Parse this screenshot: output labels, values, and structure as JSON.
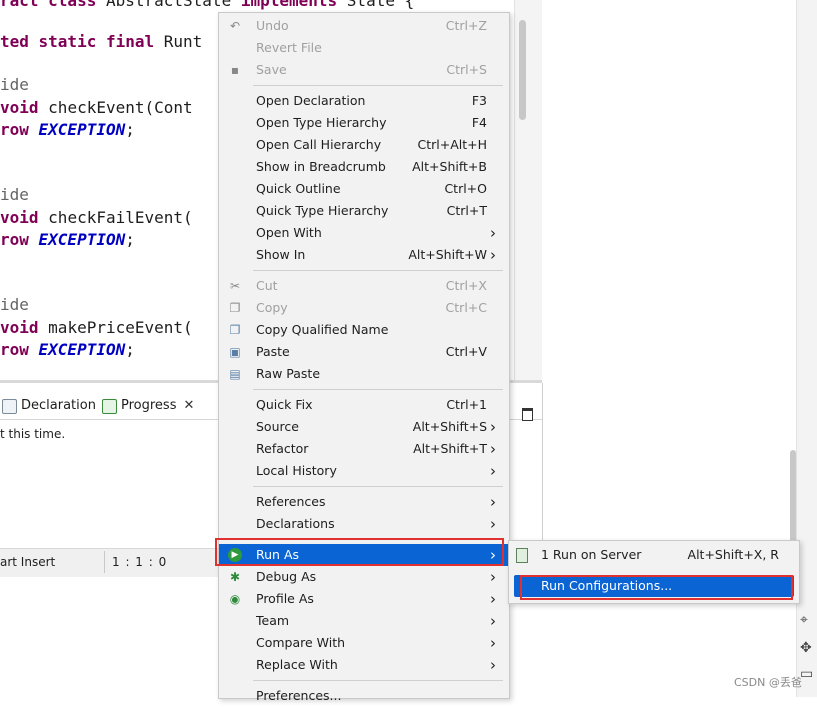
{
  "editor": {
    "lines": [
      {
        "parts": [
          [
            "kw",
            "ract class "
          ],
          [
            "",
            "AbstractState "
          ],
          [
            "kw",
            "implements "
          ],
          [
            "",
            "State {"
          ]
        ]
      },
      {
        "parts": [
          [
            "kw",
            "ted static final "
          ],
          [
            "",
            "Runt"
          ]
        ]
      },
      {
        "parts": [
          [
            "ann",
            "ide"
          ]
        ]
      },
      {
        "parts": [
          [
            "kw",
            "void "
          ],
          [
            "",
            "checkEvent(Cont"
          ]
        ]
      },
      {
        "parts": [
          [
            "kw",
            "row "
          ],
          [
            "ex",
            "EXCEPTION"
          ],
          [
            "",
            ";"
          ]
        ]
      },
      {
        "parts": [
          [
            "ann",
            "ide"
          ]
        ]
      },
      {
        "parts": [
          [
            "kw",
            "void "
          ],
          [
            "",
            "checkFailEvent("
          ]
        ]
      },
      {
        "parts": [
          [
            "kw",
            "row "
          ],
          [
            "ex",
            "EXCEPTION"
          ],
          [
            "",
            ";"
          ]
        ]
      },
      {
        "parts": [
          [
            "ann",
            "ide"
          ]
        ]
      },
      {
        "parts": [
          [
            "kw",
            "void "
          ],
          [
            "",
            "makePriceEvent("
          ]
        ]
      },
      {
        "parts": [
          [
            "kw",
            "row "
          ],
          [
            "ex",
            "EXCEPTION"
          ],
          [
            "",
            ";"
          ]
        ]
      }
    ]
  },
  "views": {
    "tabs": [
      {
        "label": "Declaration"
      },
      {
        "label": "Progress",
        "close": "✕"
      }
    ],
    "message": "t this time."
  },
  "statusbar": {
    "insert_mode": "art Insert",
    "position": "1 : 1 : 0"
  },
  "context_menu": {
    "items": [
      {
        "label": "Undo",
        "accel": "Ctrl+Z",
        "disabled": true,
        "icon": "undo-icon",
        "glyph": "↶"
      },
      {
        "label": "Revert File",
        "accel": "",
        "disabled": true
      },
      {
        "label": "Save",
        "accel": "Ctrl+S",
        "disabled": true,
        "icon": "save-icon",
        "glyph": "▪"
      },
      {
        "sep": true
      },
      {
        "label": "Open Declaration",
        "accel": "F3"
      },
      {
        "label": "Open Type Hierarchy",
        "accel": "F4"
      },
      {
        "label": "Open Call Hierarchy",
        "accel": "Ctrl+Alt+H"
      },
      {
        "label": "Show in Breadcrumb",
        "accel": "Alt+Shift+B"
      },
      {
        "label": "Quick Outline",
        "accel": "Ctrl+O"
      },
      {
        "label": "Quick Type Hierarchy",
        "accel": "Ctrl+T"
      },
      {
        "label": "Open With",
        "accel": "",
        "submenu": true
      },
      {
        "label": "Show In",
        "accel": "Alt+Shift+W",
        "submenu": true
      },
      {
        "sep": true
      },
      {
        "label": "Cut",
        "accel": "Ctrl+X",
        "disabled": true,
        "icon": "cut-icon",
        "glyph": "✂"
      },
      {
        "label": "Copy",
        "accel": "Ctrl+C",
        "disabled": true,
        "icon": "copy-icon",
        "glyph": "❐"
      },
      {
        "label": "Copy Qualified Name",
        "accel": "",
        "icon": "copy-qualified-name-icon",
        "glyph": "❐"
      },
      {
        "label": "Paste",
        "accel": "Ctrl+V",
        "icon": "paste-icon",
        "glyph": "▣"
      },
      {
        "label": "Raw Paste",
        "accel": "",
        "icon": "raw-paste-icon",
        "glyph": "▤"
      },
      {
        "sep": true
      },
      {
        "label": "Quick Fix",
        "accel": "Ctrl+1"
      },
      {
        "label": "Source",
        "accel": "Alt+Shift+S",
        "submenu": true
      },
      {
        "label": "Refactor",
        "accel": "Alt+Shift+T",
        "submenu": true
      },
      {
        "label": "Local History",
        "accel": "",
        "submenu": true
      },
      {
        "sep": true
      },
      {
        "label": "References",
        "accel": "",
        "submenu": true
      },
      {
        "label": "Declarations",
        "accel": "",
        "submenu": true
      },
      {
        "sep": true
      },
      {
        "label": "Run As",
        "accel": "",
        "submenu": true,
        "selected": true,
        "icon": "run-icon",
        "glyph": "▶"
      },
      {
        "label": "Debug As",
        "accel": "",
        "submenu": true,
        "icon": "debug-icon",
        "glyph": "✱"
      },
      {
        "label": "Profile As",
        "accel": "",
        "submenu": true,
        "icon": "profile-icon",
        "glyph": "◉"
      },
      {
        "label": "Team",
        "accel": "",
        "submenu": true
      },
      {
        "label": "Compare With",
        "accel": "",
        "submenu": true
      },
      {
        "label": "Replace With",
        "accel": "",
        "submenu": true
      },
      {
        "sep": true
      },
      {
        "label": "Preferences...",
        "accel": ""
      }
    ]
  },
  "run_as_submenu": {
    "items": [
      {
        "label": "1 Run on Server",
        "accel": "Alt+Shift+X, R"
      },
      {
        "label": "Run Configurations...",
        "accel": "",
        "selected": true
      }
    ]
  },
  "colors": {
    "selection": "#0a64d4",
    "highlight_box": "#e03030",
    "keyword": "#7f0055",
    "constant": "#0000c0"
  },
  "watermark": "CSDN @丢爸"
}
